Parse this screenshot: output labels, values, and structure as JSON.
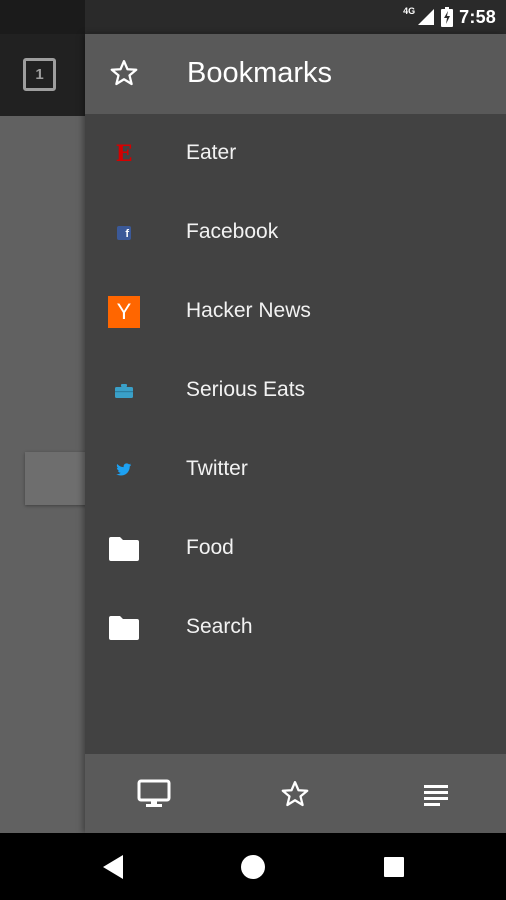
{
  "status_bar": {
    "network": "4G",
    "time": "7:58"
  },
  "background": {
    "tab_count": "1"
  },
  "drawer": {
    "title": "Bookmarks",
    "items": [
      {
        "label": "Eater",
        "icon": "eater-favicon"
      },
      {
        "label": "Facebook",
        "icon": "facebook-favicon"
      },
      {
        "label": "Hacker News",
        "icon": "hacker-news-favicon",
        "icon_text": "Y"
      },
      {
        "label": "Serious Eats",
        "icon": "serious-eats-favicon"
      },
      {
        "label": "Twitter",
        "icon": "twitter-favicon"
      },
      {
        "label": "Food",
        "icon": "folder-icon"
      },
      {
        "label": "Search",
        "icon": "folder-icon"
      }
    ],
    "eater_icon_text": "E",
    "facebook_icon_text": "f"
  },
  "bottom_bar": {
    "buttons": [
      "desktop-icon",
      "star-icon",
      "reading-list-icon"
    ]
  },
  "nav_bar": {
    "buttons": [
      "back-icon",
      "home-icon",
      "recents-icon"
    ]
  },
  "colors": {
    "drawer_bg": "#424242",
    "header_bg": "#595959",
    "eater_red": "#d50000",
    "facebook_blue": "#3b5998",
    "hacker_news_orange": "#ff6600",
    "serious_eats_blue": "#3aa0c8",
    "twitter_blue": "#1da1f2"
  }
}
